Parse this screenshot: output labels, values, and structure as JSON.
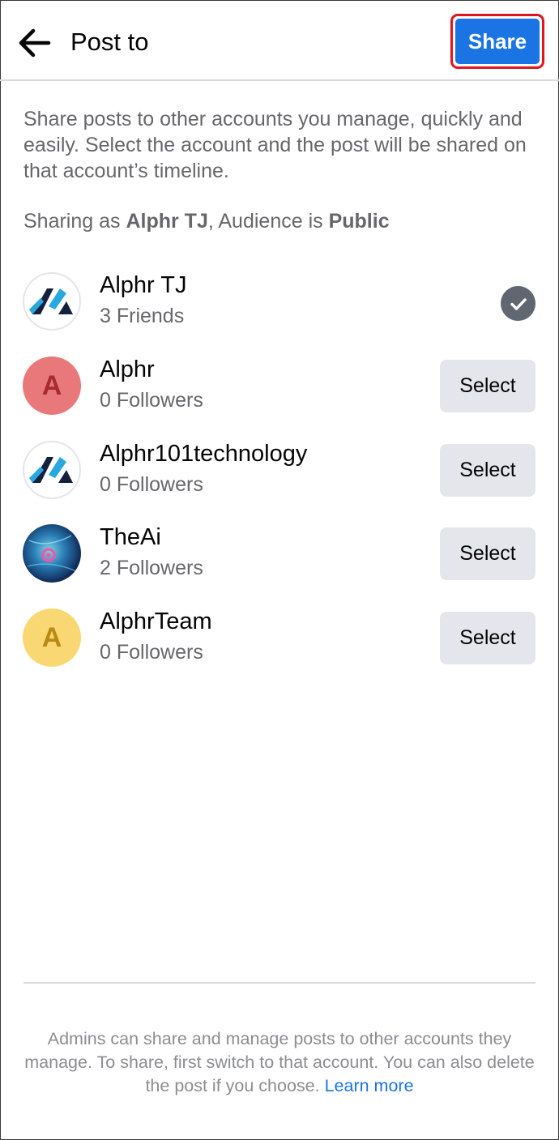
{
  "header": {
    "back_icon": "arrow-left-icon",
    "title": "Post to",
    "share_label": "Share",
    "share_color": "#1b74e4",
    "highlight_color": "#e4141f"
  },
  "intro": {
    "text": "Share posts to other accounts you manage, quickly and easily. Select the account and the post will be shared on that account’s timeline.",
    "sharing_prefix": "Sharing as ",
    "sharing_account": "Alphr TJ",
    "sharing_middle": ", Audience is ",
    "audience": "Public"
  },
  "accounts": [
    {
      "name": "Alphr TJ",
      "subtitle": "3 Friends",
      "avatar": "alphr-logo",
      "selected": true,
      "state_icon": "checkmark-icon"
    },
    {
      "name": "Alphr",
      "subtitle": "0 Followers",
      "avatar_letter": "A",
      "avatar_color": "#e9787a",
      "action_label": "Select"
    },
    {
      "name": "Alphr101technology",
      "subtitle": "0 Followers",
      "avatar": "alphr-logo",
      "action_label": "Select"
    },
    {
      "name": "TheAi",
      "subtitle": "2 Followers",
      "avatar": "photo",
      "action_label": "Select"
    },
    {
      "name": "AlphrTeam",
      "subtitle": "0 Followers",
      "avatar_letter": "A",
      "avatar_color": "#f9d773",
      "action_label": "Select"
    }
  ],
  "footer": {
    "text": "Admins can share and manage posts to other accounts they manage. To share, first switch to that account. You can also delete the post if you choose. ",
    "link_label": "Learn more",
    "link_color": "#1b74e4"
  }
}
